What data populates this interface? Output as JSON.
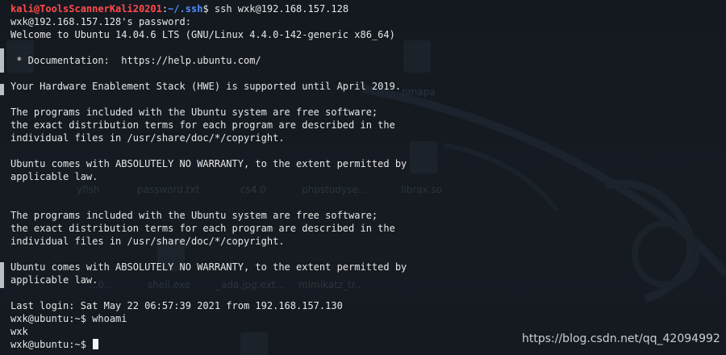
{
  "terminal": {
    "first_prompt": {
      "user_host": "kali@ToolsScannerKali20201",
      "separator": ":",
      "path": "~/.ssh",
      "symbol": "$",
      "command": " ssh wxk@192.168.157.128"
    },
    "output_lines": [
      "wxk@192.168.157.128's password:",
      "Welcome to Ubuntu 14.04.6 LTS (GNU/Linux 4.4.0-142-generic x86_64)",
      "",
      " * Documentation:  https://help.ubuntu.com/",
      "",
      "Your Hardware Enablement Stack (HWE) is supported until April 2019.",
      "",
      "The programs included with the Ubuntu system are free software;",
      "the exact distribution terms for each program are described in the",
      "individual files in /usr/share/doc/*/copyright.",
      "",
      "Ubuntu comes with ABSOLUTELY NO WARRANTY, to the extent permitted by",
      "applicable law.",
      "",
      "",
      "The programs included with the Ubuntu system are free software;",
      "the exact distribution terms for each program are described in the",
      "individual files in /usr/share/doc/*/copyright.",
      "",
      "Ubuntu comes with ABSOLUTELY NO WARRANTY, to the extent permitted by",
      "applicable law.",
      "",
      "Last login: Sat May 22 06:57:39 2021 from 192.168.157.130",
      "wxk@ubuntu:~$ whoami",
      "wxk"
    ],
    "last_prompt": "wxk@ubuntu:~$ "
  },
  "desktop_ghost_labels": {
    "nmap": "nmapa",
    "yfish": "yfish",
    "password": "password.txt",
    "cs40": "cs4.0",
    "phpstudy": "phpstudyse...",
    "librax": "librax.so",
    "o": "...0...",
    "shell": "shell.exe",
    "adajpg": "_ada.jpg.ext...",
    "mimikatz": "mimikatz_tr..."
  },
  "watermark": "https://blog.csdn.net/qq_42094992",
  "colors": {
    "prompt_user": "#ff4b4b",
    "prompt_path": "#4f8cff",
    "text": "#e6e6e6",
    "background": "#161b22"
  }
}
